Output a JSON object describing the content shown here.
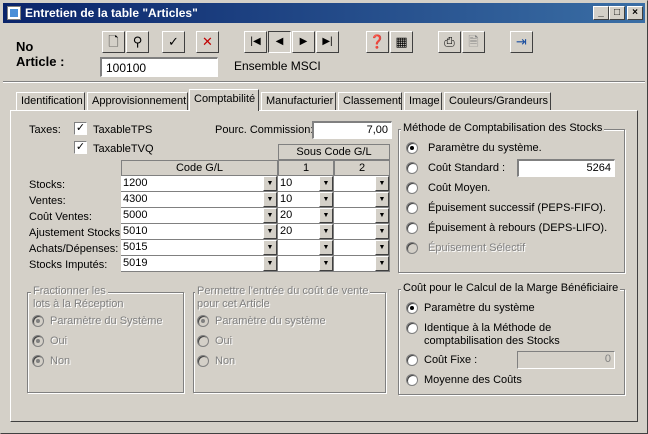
{
  "window": {
    "title": "Entretien de la table \"Articles\""
  },
  "header": {
    "no_article_label": "No",
    "no_article_label2": "Article :",
    "article_no": "100100",
    "article_desc": "Ensemble MSCI"
  },
  "tabs": [
    "Identification",
    "Approvisionnement",
    "Comptabilité",
    "Manufacturier",
    "Classement",
    "Image",
    "Couleurs/Grandeurs"
  ],
  "taxes": {
    "label": "Taxes:",
    "tps": "TaxableTPS",
    "tvq": "TaxableTVQ",
    "commission_label": "Pourc. Commission:",
    "commission_value": "7,00"
  },
  "gl_table": {
    "header_code": "Code G/L",
    "header_sous": "Sous Code G/L",
    "header_1": "1",
    "header_2": "2",
    "rows": [
      {
        "label": "Stocks:",
        "code": "1200",
        "s1": "10",
        "s2": ""
      },
      {
        "label": "Ventes:",
        "code": "4300",
        "s1": "10",
        "s2": ""
      },
      {
        "label": "Coût  Ventes:",
        "code": "5000",
        "s1": "20",
        "s2": ""
      },
      {
        "label": "Ajustement Stocks:",
        "code": "5010",
        "s1": "20",
        "s2": ""
      },
      {
        "label": "Achats/Dépenses:",
        "code": "5015",
        "s1": "",
        "s2": ""
      },
      {
        "label": "Stocks Imputés:",
        "code": "5019",
        "s1": "",
        "s2": ""
      }
    ]
  },
  "methode": {
    "title": "Méthode de Comptabilisation des Stocks",
    "options": [
      "Paramètre du système.",
      "Coût Standard :",
      "Coût Moyen.",
      "Épuisement successif (PEPS-FIFO).",
      "Épuisement à rebours (DEPS-LIFO).",
      "Épuisement Sélectif"
    ],
    "cout_standard_value": "5264"
  },
  "marge": {
    "title": "Coût pour le Calcul de la Marge Bénéficiaire",
    "options": [
      "Paramètre du système",
      "Identique à la Méthode de",
      "comptabilisation des Stocks",
      "Coût Fixe :",
      "Moyenne des Coûts"
    ],
    "cout_fixe_value": "0"
  },
  "fractionner": {
    "title1": "Fractionner les",
    "title2": "lots à la Réception",
    "options": [
      "Paramètre du Système",
      "Oui",
      "Non"
    ]
  },
  "permettre": {
    "title1": "Permettre l'entrée du coût de vente",
    "title2": "pour cet Article",
    "options": [
      "Paramètre du système",
      "Oui",
      "Non"
    ]
  }
}
